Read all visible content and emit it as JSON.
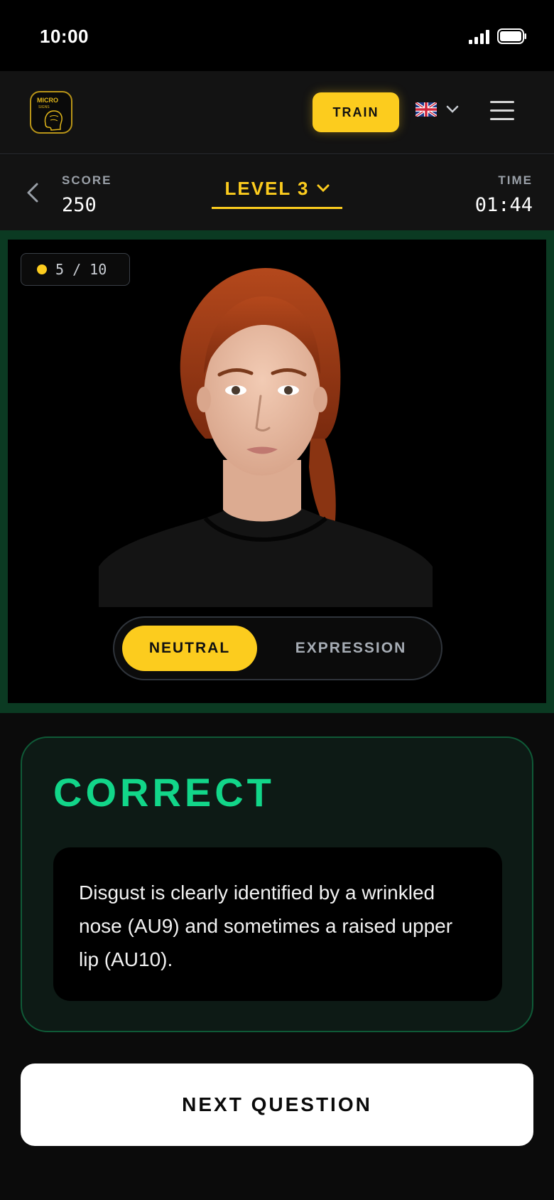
{
  "status_bar": {
    "time": "10:00"
  },
  "header": {
    "logo": {
      "line1": "MICRO",
      "line2": "SIGNS"
    },
    "train_label": "TRAIN",
    "language": "gb-flag-icon"
  },
  "score_bar": {
    "score_label": "SCORE",
    "score_value": "250",
    "level_label": "LEVEL 3",
    "time_label": "TIME",
    "time_value": "01:44"
  },
  "question": {
    "progress": "5 / 10",
    "toggle": {
      "active": "NEUTRAL",
      "inactive": "EXPRESSION"
    }
  },
  "result": {
    "title": "CORRECT",
    "explanation": "Disgust is clearly identified by a wrinkled nose (AU9) and sometimes a raised upper lip (AU10)."
  },
  "next_label": "NEXT QUESTION",
  "colors": {
    "accent": "#fccc1e",
    "success": "#12d689",
    "frame": "#0b3a22"
  }
}
